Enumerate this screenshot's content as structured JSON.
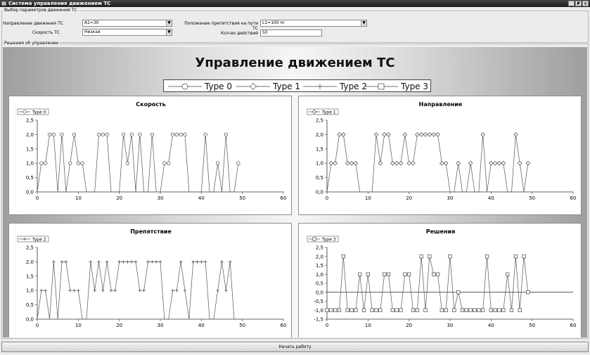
{
  "window": {
    "title": "Система управления движением ТС",
    "controls": [
      "_",
      "₽",
      "×"
    ]
  },
  "params_group": {
    "title": "Выбор параметров движения ТС",
    "direction_label": "Направление движения ТС",
    "direction_value": "A1=30",
    "speed_label": "Скорость ТС",
    "speed_value": "Низкая",
    "obstacle_label": "Положение препятствия на пути ТС",
    "obstacle_value": "L1=100 m",
    "count_label": "Кол-во действий",
    "count_value": "50"
  },
  "decisions_group": {
    "title": "Решения об управлении"
  },
  "main_chart": {
    "title": "Управление движением ТС",
    "legend": [
      "Type 0",
      "Type 1",
      "Type 2",
      "Type 3"
    ]
  },
  "chart_data": [
    {
      "type": "line",
      "title": "Скорость",
      "legend": "Type 0",
      "marker": "circle",
      "xlim": [
        0,
        60
      ],
      "ylim": [
        0,
        2.5
      ],
      "xticks": [
        "0",
        "10",
        "20",
        "30",
        "40",
        "50",
        "60"
      ],
      "yticks": [
        "0,0",
        "0,5",
        "1,0",
        "1,5",
        "2,0",
        "2,5"
      ],
      "x": [
        0,
        1,
        2,
        3,
        4,
        5,
        6,
        7,
        8,
        9,
        10,
        11,
        12,
        13,
        14,
        15,
        16,
        17,
        18,
        19,
        20,
        21,
        22,
        23,
        24,
        25,
        26,
        27,
        28,
        29,
        30,
        31,
        32,
        33,
        34,
        35,
        36,
        37,
        38,
        39,
        40,
        41,
        42,
        43,
        44,
        45,
        46,
        47,
        48,
        49
      ],
      "y": [
        0,
        1,
        1,
        2,
        2,
        0,
        2,
        0,
        1,
        2,
        1,
        1,
        0,
        0,
        0,
        2,
        2,
        2,
        0,
        0,
        0,
        2,
        1,
        2,
        0,
        2,
        0,
        0,
        2,
        0,
        0,
        1,
        1,
        2,
        2,
        2,
        2,
        0,
        0,
        0,
        0,
        2,
        0,
        0,
        1,
        0,
        2,
        0,
        0,
        1
      ]
    },
    {
      "type": "line",
      "title": "Направление",
      "legend": "Type 1",
      "marker": "diamond",
      "xlim": [
        0,
        60
      ],
      "ylim": [
        0,
        2.5
      ],
      "xticks": [
        "0",
        "10",
        "20",
        "30",
        "40",
        "50",
        "60"
      ],
      "yticks": [
        "0,0",
        "0,5",
        "1,0",
        "1,5",
        "2,0",
        "2,5"
      ],
      "x": [
        0,
        1,
        2,
        3,
        4,
        5,
        6,
        7,
        8,
        9,
        10,
        11,
        12,
        13,
        14,
        15,
        16,
        17,
        18,
        19,
        20,
        21,
        22,
        23,
        24,
        25,
        26,
        27,
        28,
        29,
        30,
        31,
        32,
        33,
        34,
        35,
        36,
        37,
        38,
        39,
        40,
        41,
        42,
        43,
        44,
        45,
        46,
        47,
        48,
        49
      ],
      "y": [
        0,
        1,
        1,
        2,
        2,
        1,
        1,
        1,
        0,
        0,
        0,
        0,
        2,
        1,
        2,
        2,
        1,
        1,
        1,
        2,
        1,
        1,
        2,
        2,
        2,
        2,
        2,
        2,
        1,
        1,
        0,
        0,
        1,
        0,
        0,
        1,
        0,
        0,
        2,
        0,
        1,
        1,
        1,
        1,
        0,
        0,
        2,
        1,
        0,
        1
      ]
    },
    {
      "type": "line",
      "title": "Препятствие",
      "legend": "Type 2",
      "marker": "plus",
      "xlim": [
        0,
        60
      ],
      "ylim": [
        0,
        2.5
      ],
      "xticks": [
        "0",
        "10",
        "20",
        "30",
        "40",
        "50",
        "60"
      ],
      "yticks": [
        "0,0",
        "0,5",
        "1,0",
        "1,5",
        "2,0",
        "2,5"
      ],
      "x": [
        0,
        1,
        2,
        3,
        4,
        5,
        6,
        7,
        8,
        9,
        10,
        11,
        12,
        13,
        14,
        15,
        16,
        17,
        18,
        19,
        20,
        21,
        22,
        23,
        24,
        25,
        26,
        27,
        28,
        29,
        30,
        31,
        32,
        33,
        34,
        35,
        36,
        37,
        38,
        39,
        40,
        41,
        42,
        43,
        44,
        45,
        46,
        47,
        48,
        49
      ],
      "y": [
        0,
        1,
        1,
        0,
        2,
        0,
        2,
        2,
        1,
        1,
        1,
        0,
        0,
        2,
        1,
        2,
        1,
        2,
        1,
        1,
        2,
        2,
        2,
        2,
        2,
        1,
        1,
        2,
        2,
        2,
        2,
        0,
        0,
        1,
        1,
        2,
        1,
        0,
        2,
        2,
        2,
        2,
        0,
        0,
        1,
        2,
        1,
        2,
        0,
        0
      ]
    },
    {
      "type": "line",
      "title": "Решения",
      "legend": "Type 3",
      "marker": "square",
      "xlim": [
        0,
        60
      ],
      "ylim": [
        -1.5,
        2.5
      ],
      "xticks": [
        "0",
        "10",
        "20",
        "30",
        "40",
        "50",
        "60"
      ],
      "yticks": [
        "-1,5",
        "-1,0",
        "-0,5",
        "0,0",
        "0,5",
        "1,0",
        "1,5",
        "2,0",
        "2,5"
      ],
      "x": [
        0,
        1,
        2,
        3,
        4,
        5,
        6,
        7,
        8,
        9,
        10,
        11,
        12,
        13,
        14,
        15,
        16,
        17,
        18,
        19,
        20,
        21,
        22,
        23,
        24,
        25,
        26,
        27,
        28,
        29,
        30,
        31,
        32,
        33,
        34,
        35,
        36,
        37,
        38,
        39,
        40,
        41,
        42,
        43,
        44,
        45,
        46,
        47,
        48,
        49
      ],
      "y": [
        -1,
        -1,
        -1,
        -1,
        2,
        -1,
        -1,
        -1,
        1,
        -1,
        1,
        -1,
        -1,
        -1,
        1,
        1,
        -1,
        -1,
        -1,
        1,
        1,
        -1,
        -1,
        2,
        -1,
        2,
        1,
        1,
        -1,
        -1,
        2,
        -1,
        0,
        -1,
        -1,
        -1,
        -1,
        -1,
        -1,
        2,
        -1,
        -1,
        -1,
        -1,
        1,
        -1,
        2,
        -1,
        2,
        0
      ]
    }
  ],
  "start_button": "Начать работу"
}
